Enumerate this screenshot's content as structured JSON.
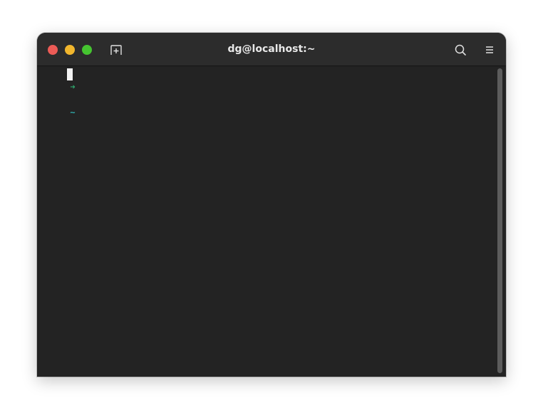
{
  "window": {
    "title": "dg@localhost:~"
  },
  "terminal": {
    "prompt_arrow": "➜",
    "prompt_dir": "~"
  },
  "icons": {
    "close": "close-icon",
    "minimize": "minimize-icon",
    "maximize": "maximize-icon",
    "new_tab": "new-tab-icon",
    "search": "search-icon",
    "menu": "hamburger-menu-icon"
  },
  "colors": {
    "close": "#ec5b56",
    "minimize": "#f1b62d",
    "maximize": "#45c430",
    "titlebar": "#2c2c2c",
    "terminal_bg": "#232323",
    "prompt_arrow": "#2fa86e",
    "prompt_dir": "#2fa8a8",
    "cursor": "#f2f2f2"
  }
}
